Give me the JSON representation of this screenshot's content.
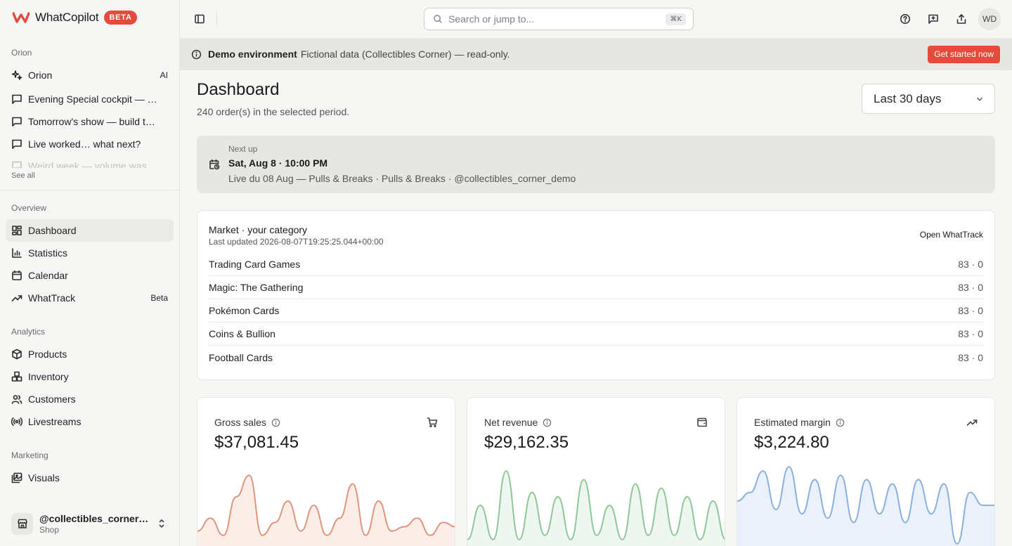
{
  "app": {
    "name": "WhatCopilot",
    "badge": "BETA",
    "brand_color": "#e54b3c"
  },
  "sidebar": {
    "orion_label": "Orion",
    "orion_items": [
      {
        "label": "Orion",
        "tag": "AI",
        "icon": "sparkles-icon"
      },
      {
        "label": "Evening Special cockpit — …",
        "icon": "chat-icon"
      },
      {
        "label": "Tomorrow's show — build t…",
        "icon": "chat-icon"
      },
      {
        "label": "Live worked… what next?",
        "icon": "chat-icon"
      },
      {
        "label": "Weird week — volume was …",
        "icon": "chat-icon"
      }
    ],
    "see_all": "See all",
    "overview_label": "Overview",
    "overview_items": [
      {
        "label": "Dashboard",
        "icon": "grid-icon",
        "active": true
      },
      {
        "label": "Statistics",
        "icon": "bar-chart-icon"
      },
      {
        "label": "Calendar",
        "icon": "calendar-icon"
      },
      {
        "label": "WhatTrack",
        "tag": "Beta",
        "icon": "trending-icon"
      }
    ],
    "analytics_label": "Analytics",
    "analytics_items": [
      {
        "label": "Products",
        "icon": "box-icon"
      },
      {
        "label": "Inventory",
        "icon": "boxes-icon"
      },
      {
        "label": "Customers",
        "icon": "users-icon"
      },
      {
        "label": "Livestreams",
        "icon": "broadcast-icon"
      }
    ],
    "marketing_label": "Marketing",
    "marketing_items": [
      {
        "label": "Visuals",
        "icon": "images-icon"
      }
    ],
    "shop": {
      "name": "@collectibles_corner_demo",
      "sub": "Shop"
    }
  },
  "topbar": {
    "search_placeholder": "Search or jump to...",
    "shortcut": "⌘K",
    "avatar_initials": "WD"
  },
  "banner": {
    "title": "Demo environment",
    "text": "Fictional data (Collectibles Corner) — read-only.",
    "cta": "Get started now"
  },
  "main": {
    "title": "Dashboard",
    "subtitle": "240 order(s) in the selected period.",
    "period": "Last 30 days",
    "next_up": {
      "label": "Next up",
      "when": "Sat, Aug 8 · 10:00 PM",
      "desc": "Live du 08 Aug — Pulls & Breaks · Pulls & Breaks · @collectibles_corner_demo"
    },
    "market": {
      "title": "Market · your category",
      "updated": "Last updated 2026-08-07T19:25:25.044+00:00",
      "link": "Open WhatTrack",
      "rows": [
        {
          "name": "Trading Card Games",
          "value": "83 · 0"
        },
        {
          "name": "Magic: The Gathering",
          "value": "83 · 0"
        },
        {
          "name": "Pokémon Cards",
          "value": "83 · 0"
        },
        {
          "name": "Coins & Bullion",
          "value": "83 · 0"
        },
        {
          "name": "Football Cards",
          "value": "83 · 0"
        }
      ]
    },
    "kpis": [
      {
        "label": "Gross sales",
        "value": "$37,081.45",
        "icon": "cart-icon",
        "color": "#e0957a",
        "fill": "#fbeee8"
      },
      {
        "label": "Net revenue",
        "value": "$29,162.35",
        "icon": "wallet-icon",
        "color": "#8fc79a",
        "fill": "#eef7ef"
      },
      {
        "label": "Estimated margin",
        "value": "$3,224.80",
        "icon": "trending-up-icon",
        "color": "#8ab0de",
        "fill": "#eaf1fa"
      }
    ]
  },
  "chart_data": [
    {
      "type": "line",
      "series": [
        {
          "values": [
            0.15,
            0.3,
            0.1,
            0.55,
            0.8,
            0.1,
            0.25,
            0.5,
            0.15,
            0.45,
            0.1,
            0.3,
            0.7,
            0.1,
            0.5,
            0.15,
            0.2,
            0.3,
            0.1,
            0.25,
            0.2
          ]
        }
      ]
    },
    {
      "type": "line",
      "series": [
        {
          "values": [
            0.05,
            0.45,
            0.05,
            0.85,
            0.05,
            0.6,
            0.1,
            0.55,
            0.05,
            0.75,
            0.1,
            0.45,
            0.05,
            0.7,
            0.1,
            0.65,
            0.1,
            0.55,
            0.05,
            0.5,
            0.05
          ]
        }
      ]
    },
    {
      "type": "line",
      "series": [
        {
          "values": [
            0.5,
            0.6,
            0.85,
            0.4,
            0.9,
            0.35,
            0.75,
            0.3,
            0.8,
            0.25,
            0.75,
            0.35,
            0.7,
            0.25,
            0.75,
            0.35,
            0.7,
            0.0,
            0.6,
            0.45,
            0.45
          ]
        }
      ]
    }
  ]
}
